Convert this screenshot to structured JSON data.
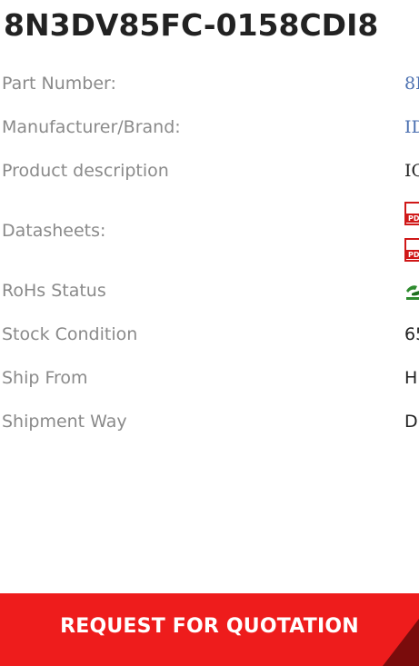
{
  "title": "8N3DV85FC-0158CDI8",
  "specs": {
    "part_number": {
      "label": "Part Number:",
      "value": "8N"
    },
    "manufacturer": {
      "label": "Manufacturer/Brand:",
      "value": "ID"
    },
    "description": {
      "label": "Product description",
      "value": "IC"
    },
    "datasheets": {
      "label": "Datasheets:",
      "icons": [
        "pdf-icon",
        "pdf-icon"
      ]
    },
    "rohs": {
      "label": "RoHs Status",
      "icon": "rohs-icon"
    },
    "stock": {
      "label": "Stock Condition",
      "value": "65"
    },
    "ship_from": {
      "label": "Ship From",
      "value": "H"
    },
    "shipment_way": {
      "label": "Shipment Way",
      "value": "D"
    }
  },
  "cta": {
    "label": "REQUEST FOR QUOTATION"
  },
  "colors": {
    "accent": "#ee1c1c",
    "link": "#4a6fb0",
    "label": "#8a8a8a"
  }
}
